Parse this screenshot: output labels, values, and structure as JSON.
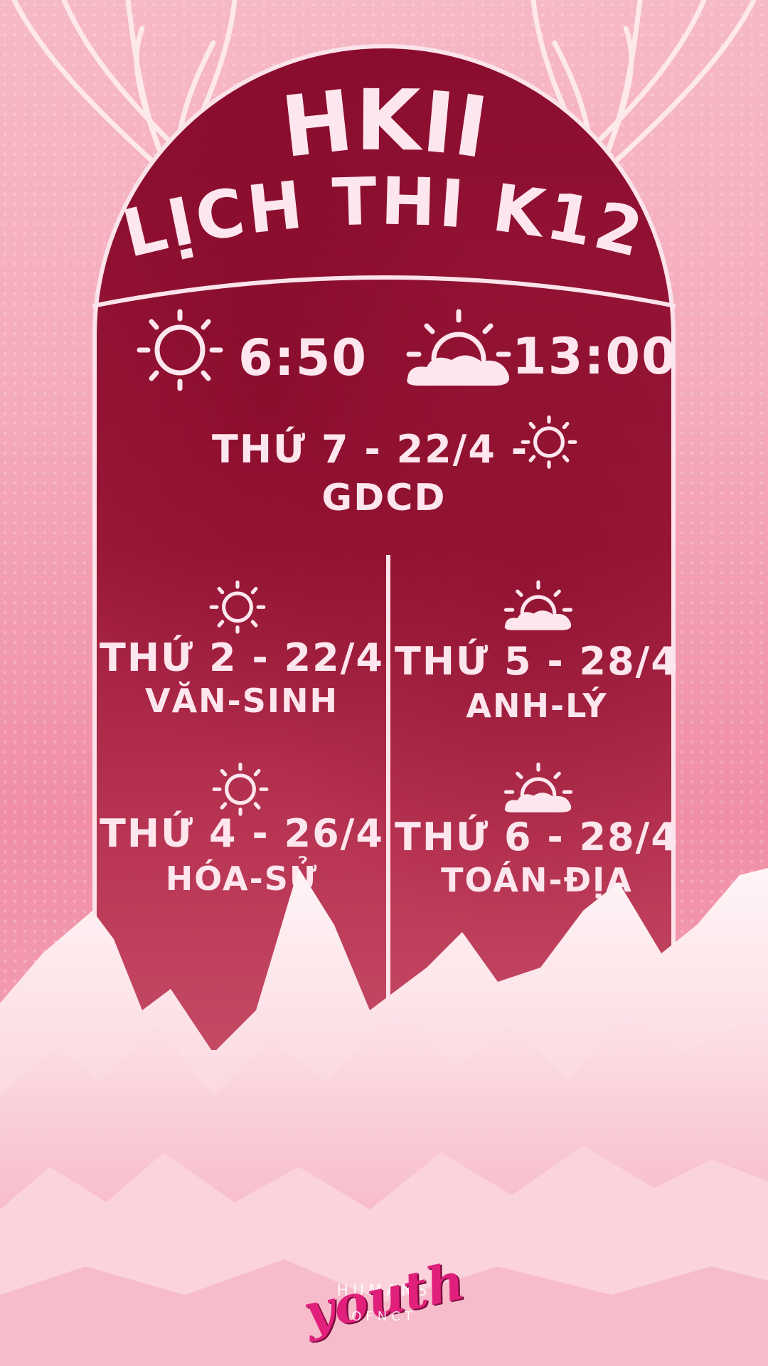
{
  "title": {
    "line1": "HKII",
    "line2": "LỊCH THI K12"
  },
  "sessions": {
    "morning": {
      "time": "6:50",
      "icon": "sun-icon"
    },
    "afternoon": {
      "time": "13:00",
      "icon": "sun-cloud-icon"
    }
  },
  "exams": [
    {
      "date": "THỨ 7 - 22/4 -",
      "subject": "GDCD",
      "icon": "sun-icon"
    },
    {
      "date": "THỨ 2 - 22/4",
      "subject": "VĂN-SINH",
      "icon": "sun-icon"
    },
    {
      "date": "THỨ 5 - 28/4",
      "subject": "ANH-LÝ",
      "icon": "sun-cloud-icon"
    },
    {
      "date": "THỨ 4 - 26/4",
      "subject": "HÓA-SỬ",
      "icon": "sun-icon"
    },
    {
      "date": "THỨ 6 - 28/4",
      "subject": "TOÁN-ĐỊA",
      "icon": "sun-cloud-icon"
    }
  ],
  "logo": {
    "script": "youth",
    "top": "HUMANS",
    "bottom": "OFNCT"
  },
  "colors": {
    "arch": "#8a0d2f",
    "text": "#fde6ee",
    "background": "#f5aabb",
    "mountain": "#fbe3ea",
    "logo": "#e0207a"
  }
}
